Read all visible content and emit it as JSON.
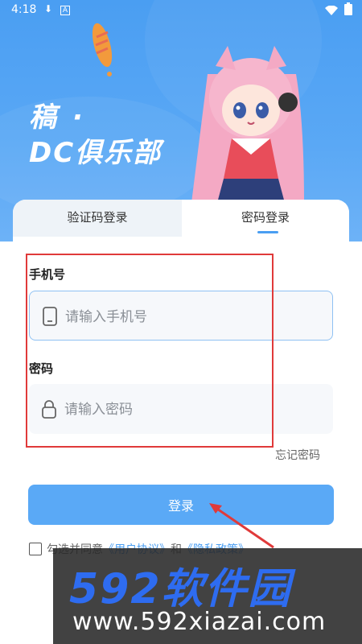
{
  "status_bar": {
    "time": "4:18",
    "download_icon": "download-icon",
    "a_icon": "A",
    "wifi_icon": "wifi-icon",
    "battery_icon": "battery-icon"
  },
  "brand": {
    "line1": "稿 ·",
    "line2": "DC俱乐部"
  },
  "tabs": [
    {
      "label": "验证码登录",
      "active": false
    },
    {
      "label": "密码登录",
      "active": true
    }
  ],
  "form": {
    "phone_label": "手机号",
    "phone_placeholder": "请输入手机号",
    "password_label": "密码",
    "password_placeholder": "请输入密码",
    "forgot": "忘记密码",
    "login_button": "登录"
  },
  "agreement": {
    "prefix": "勾选并同意",
    "user_agreement": "《用户协议》",
    "and": "和",
    "privacy": "《隐私政策》"
  },
  "watermark": {
    "big": "592软件园",
    "url": "www.592xiazai.com"
  },
  "colors": {
    "primary": "#4a9ef2",
    "button": "#5aa9f6",
    "highlight": "#e03a3a"
  }
}
